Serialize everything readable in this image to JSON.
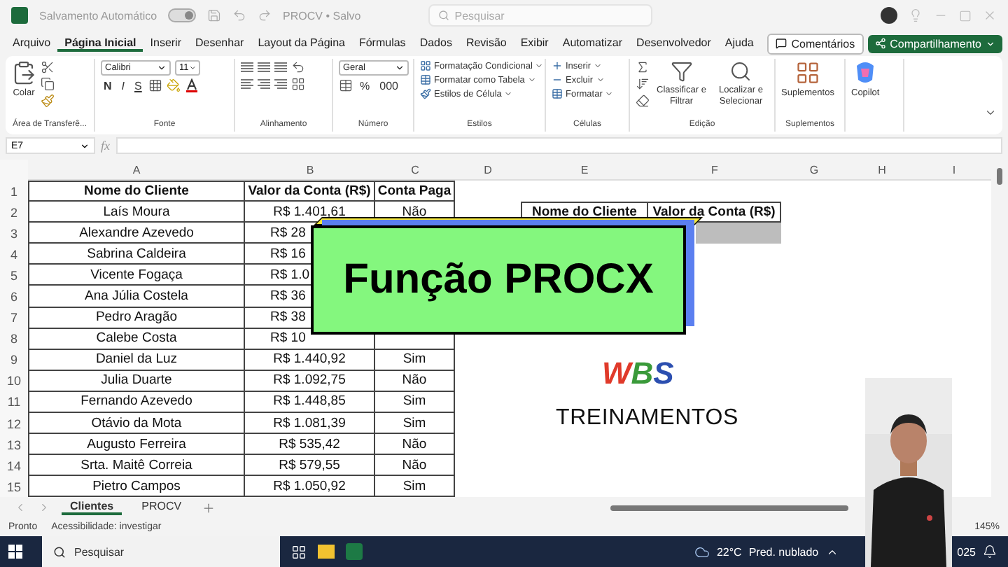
{
  "title_bar": {
    "autosave_label": "Salvamento Automático",
    "autosave_on": true,
    "file_name": "PROCV • Salvo",
    "search_placeholder": "Pesquisar"
  },
  "menu_tabs": [
    {
      "label": "Arquivo",
      "selected": false
    },
    {
      "label": "Página Inicial",
      "selected": true
    },
    {
      "label": "Inserir",
      "selected": false
    },
    {
      "label": "Desenhar",
      "selected": false
    },
    {
      "label": "Layout da Página",
      "selected": false
    },
    {
      "label": "Fórmulas",
      "selected": false
    },
    {
      "label": "Dados",
      "selected": false
    },
    {
      "label": "Revisão",
      "selected": false
    },
    {
      "label": "Exibir",
      "selected": false
    },
    {
      "label": "Automatizar",
      "selected": false
    },
    {
      "label": "Desenvolvedor",
      "selected": false
    },
    {
      "label": "Ajuda",
      "selected": false
    }
  ],
  "actions": [
    {
      "label": "Comentários",
      "kind": "outline"
    },
    {
      "label": "Compartilhamento",
      "kind": "primary"
    }
  ],
  "ribbon_groups": [
    {
      "kind": "clipboard",
      "title": "Área de Transferê...",
      "labels": [
        "Colar"
      ]
    },
    {
      "kind": "font",
      "title": "Fonte",
      "labels": [
        "Calibri",
        "11",
        "N",
        "I",
        "S"
      ]
    },
    {
      "kind": "alignment",
      "title": "Alinhamento"
    },
    {
      "kind": "number",
      "title": "Número",
      "labels": [
        "Geral",
        "%",
        "000"
      ]
    },
    {
      "kind": "list",
      "title": "Estilos",
      "labels": [
        "Formatação Condicional",
        "Formatar como Tabela",
        "Estilos de Célula"
      ]
    },
    {
      "kind": "list",
      "title": "Células",
      "labels": [
        "Inserir",
        "Excluir",
        "Formatar"
      ]
    },
    {
      "kind": "editing",
      "title": "Edição",
      "labels": [
        "Classificar e Filtrar",
        "Localizar e Selecionar"
      ]
    },
    {
      "kind": "large",
      "title": "Suplementos",
      "labels": [
        "Suplementos"
      ]
    },
    {
      "kind": "copilot",
      "labels": [
        "Copilot"
      ]
    }
  ],
  "formula_bar": {
    "cell_ref": "E7",
    "function_label": "fx"
  },
  "columns": [
    "A",
    "B",
    "C",
    "D",
    "E",
    "F",
    "G",
    "H",
    "I"
  ],
  "rows": [
    {
      "number": "1",
      "kind": "header",
      "cells": [
        {
          "text": "Nome do Cliente"
        },
        {
          "text": "Valor da Conta (R$)"
        },
        {
          "text": "Conta Paga"
        }
      ]
    },
    {
      "number": "2",
      "cells": [
        {
          "text": "Laís Moura"
        },
        {
          "text": "R$ 1.401,61"
        },
        {
          "text": "Não"
        }
      ]
    },
    {
      "number": "3",
      "cells": [
        {
          "text": "Alexandre Azevedo"
        },
        {
          "text": "R$ 28",
          "cut": true
        }
      ]
    },
    {
      "number": "4",
      "cells": [
        {
          "text": "Sabrina Caldeira"
        },
        {
          "text": "R$ 16",
          "cut": true
        }
      ]
    },
    {
      "number": "5",
      "cells": [
        {
          "text": "Vicente Fogaça"
        },
        {
          "text": "R$ 1.0",
          "cut": true
        }
      ]
    },
    {
      "number": "6",
      "cells": [
        {
          "text": "Ana Júlia Costela"
        },
        {
          "text": "R$ 36",
          "cut": true
        }
      ]
    },
    {
      "number": "7",
      "cells": [
        {
          "text": "Pedro Aragão"
        },
        {
          "text": "R$ 38",
          "cut": true
        }
      ]
    },
    {
      "number": "8",
      "cells": [
        {
          "text": "Calebe Costa"
        },
        {
          "text": "R$ 10",
          "cut": true
        }
      ]
    },
    {
      "number": "9",
      "cells": [
        {
          "text": "Daniel da Luz"
        },
        {
          "text": "R$ 1.440,92"
        },
        {
          "text": "Sim"
        }
      ]
    },
    {
      "number": "10",
      "cells": [
        {
          "text": "Julia Duarte"
        },
        {
          "text": "R$ 1.092,75"
        },
        {
          "text": "Não"
        }
      ]
    },
    {
      "number": "11",
      "cells": [
        {
          "text": "Fernando Azevedo"
        },
        {
          "text": "R$ 1.448,85"
        },
        {
          "text": "Sim"
        }
      ]
    },
    {
      "number": "12",
      "cells": [
        {
          "text": "Otávio da Mota"
        },
        {
          "text": "R$ 1.081,39"
        },
        {
          "text": "Sim"
        }
      ]
    },
    {
      "number": "13",
      "cells": [
        {
          "text": "Augusto Ferreira"
        },
        {
          "text": "R$ 535,42"
        },
        {
          "text": "Não"
        }
      ]
    },
    {
      "number": "14",
      "cells": [
        {
          "text": "Srta. Maitê Correia"
        },
        {
          "text": "R$ 579,55"
        },
        {
          "text": "Não"
        }
      ]
    },
    {
      "number": "15",
      "cells": [
        {
          "text": "Pietro Campos"
        },
        {
          "text": "R$ 1.050,92"
        },
        {
          "text": "Sim"
        }
      ]
    }
  ],
  "lookup_table": {
    "columns": [
      "Nome do Cliente",
      "Valor da Conta (R$)"
    ]
  },
  "banner": {
    "text": "Função PROCX"
  },
  "logo": {
    "letters": [
      "W",
      "B",
      "S"
    ],
    "caption": "TREINAMENTOS"
  },
  "sheet_tabs": [
    {
      "label": "Clientes",
      "selected": true
    },
    {
      "label": "PROCV",
      "selected": false
    }
  ],
  "status_bar": {
    "status": "Pronto",
    "accessibility": "Acessibilidade: investigar",
    "zoom": "145%"
  },
  "taskbar": {
    "search_placeholder": "Pesquisar",
    "temperature": "22°C",
    "weather": "Pred. nublado",
    "clock": "025"
  }
}
